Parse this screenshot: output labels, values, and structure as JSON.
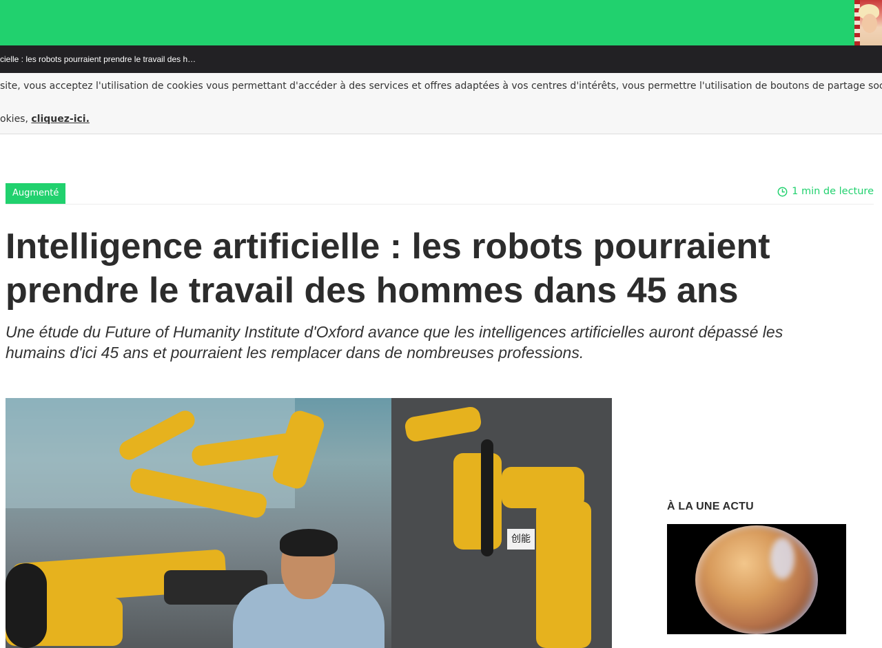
{
  "header": {
    "bar_color": "#21d16e",
    "avatar_icon": "user-avatar-thumbnail"
  },
  "titlebar": {
    "text": "cielle : les robots pourraient prendre le travail des h…"
  },
  "cookie_banner": {
    "line1": "site, vous acceptez l'utilisation de cookies vous permettant d'accéder à des services et offres adaptées à vos centres d'intérêts, vous permettre l'utilisation de boutons de partage sociau",
    "line2_prefix": "okies, ",
    "link_label": "cliquez-ici."
  },
  "article": {
    "category": "Augmenté",
    "read_time": "1 min de lecture",
    "title": "Intelligence artificielle : les robots pourraient prendre le travail des hommes dans 45 ans",
    "lead": "Une étude du Future of Humanity Institute d'Oxford avance que les intelligences artificielles auront dépassé les humains d'ici 45 ans et pourraient les remplacer dans de nombreuses professions.",
    "hero_sign": "创能"
  },
  "sidebar": {
    "heading": "À LA UNE ACTU"
  },
  "colors": {
    "accent": "#21d16e",
    "dark_bar": "#222124"
  }
}
